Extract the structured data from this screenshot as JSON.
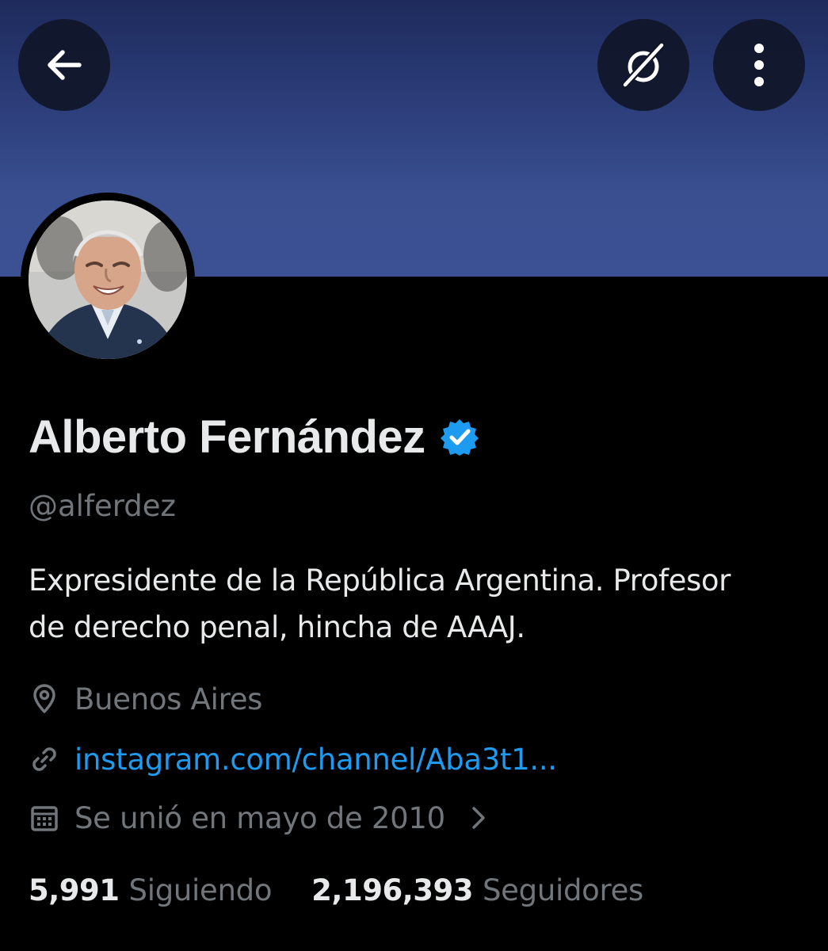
{
  "header": {
    "back_icon": "arrow-left-icon",
    "grok_icon": "grok-icon",
    "more_icon": "more-vertical-icon",
    "banner_color": "#3b5193"
  },
  "profile": {
    "display_name": "Alberto Fernández",
    "verified": true,
    "verified_color": "#1d9bf0",
    "handle": "@alferdez",
    "bio_line1": "Expresidente de la República Argentina. Profesor",
    "bio_line2": "de derecho penal, hincha de AAAJ.",
    "location": "Buenos Aires",
    "website": "instagram.com/channel/Aba3t1...",
    "joined": "Se unió en mayo de 2010"
  },
  "stats": {
    "following_count": "5,991",
    "following_label": "Siguiendo",
    "followers_count": "2,196,393",
    "followers_label": "Seguidores"
  },
  "colors": {
    "background": "#000000",
    "primary_text": "#e7e9ea",
    "secondary_text": "#71767b",
    "link": "#1d9bf0"
  }
}
